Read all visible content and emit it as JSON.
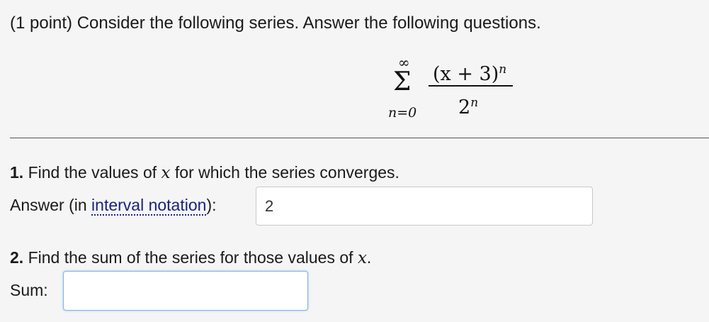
{
  "problem": {
    "intro": "(1 point) Consider the following series. Answer the following questions."
  },
  "series": {
    "upper_limit": "∞",
    "sigma": "Σ",
    "lower_limit": "n=0",
    "numerator_base": "(x + 3)",
    "numerator_exponent": "n",
    "denominator_base": "2",
    "denominator_exponent": "n"
  },
  "question1": {
    "number": "1.",
    "text_before": " Find the values of ",
    "variable": "x",
    "text_after": " for which the series converges.",
    "answer_label_before": "Answer (in ",
    "answer_link": "interval notation",
    "answer_label_after": "):",
    "answer_value": "2"
  },
  "question2": {
    "number": "2.",
    "text_before": " Find the sum of the series for those values of ",
    "variable": "x",
    "text_after": ".",
    "sum_label": "Sum:",
    "sum_value": ""
  }
}
